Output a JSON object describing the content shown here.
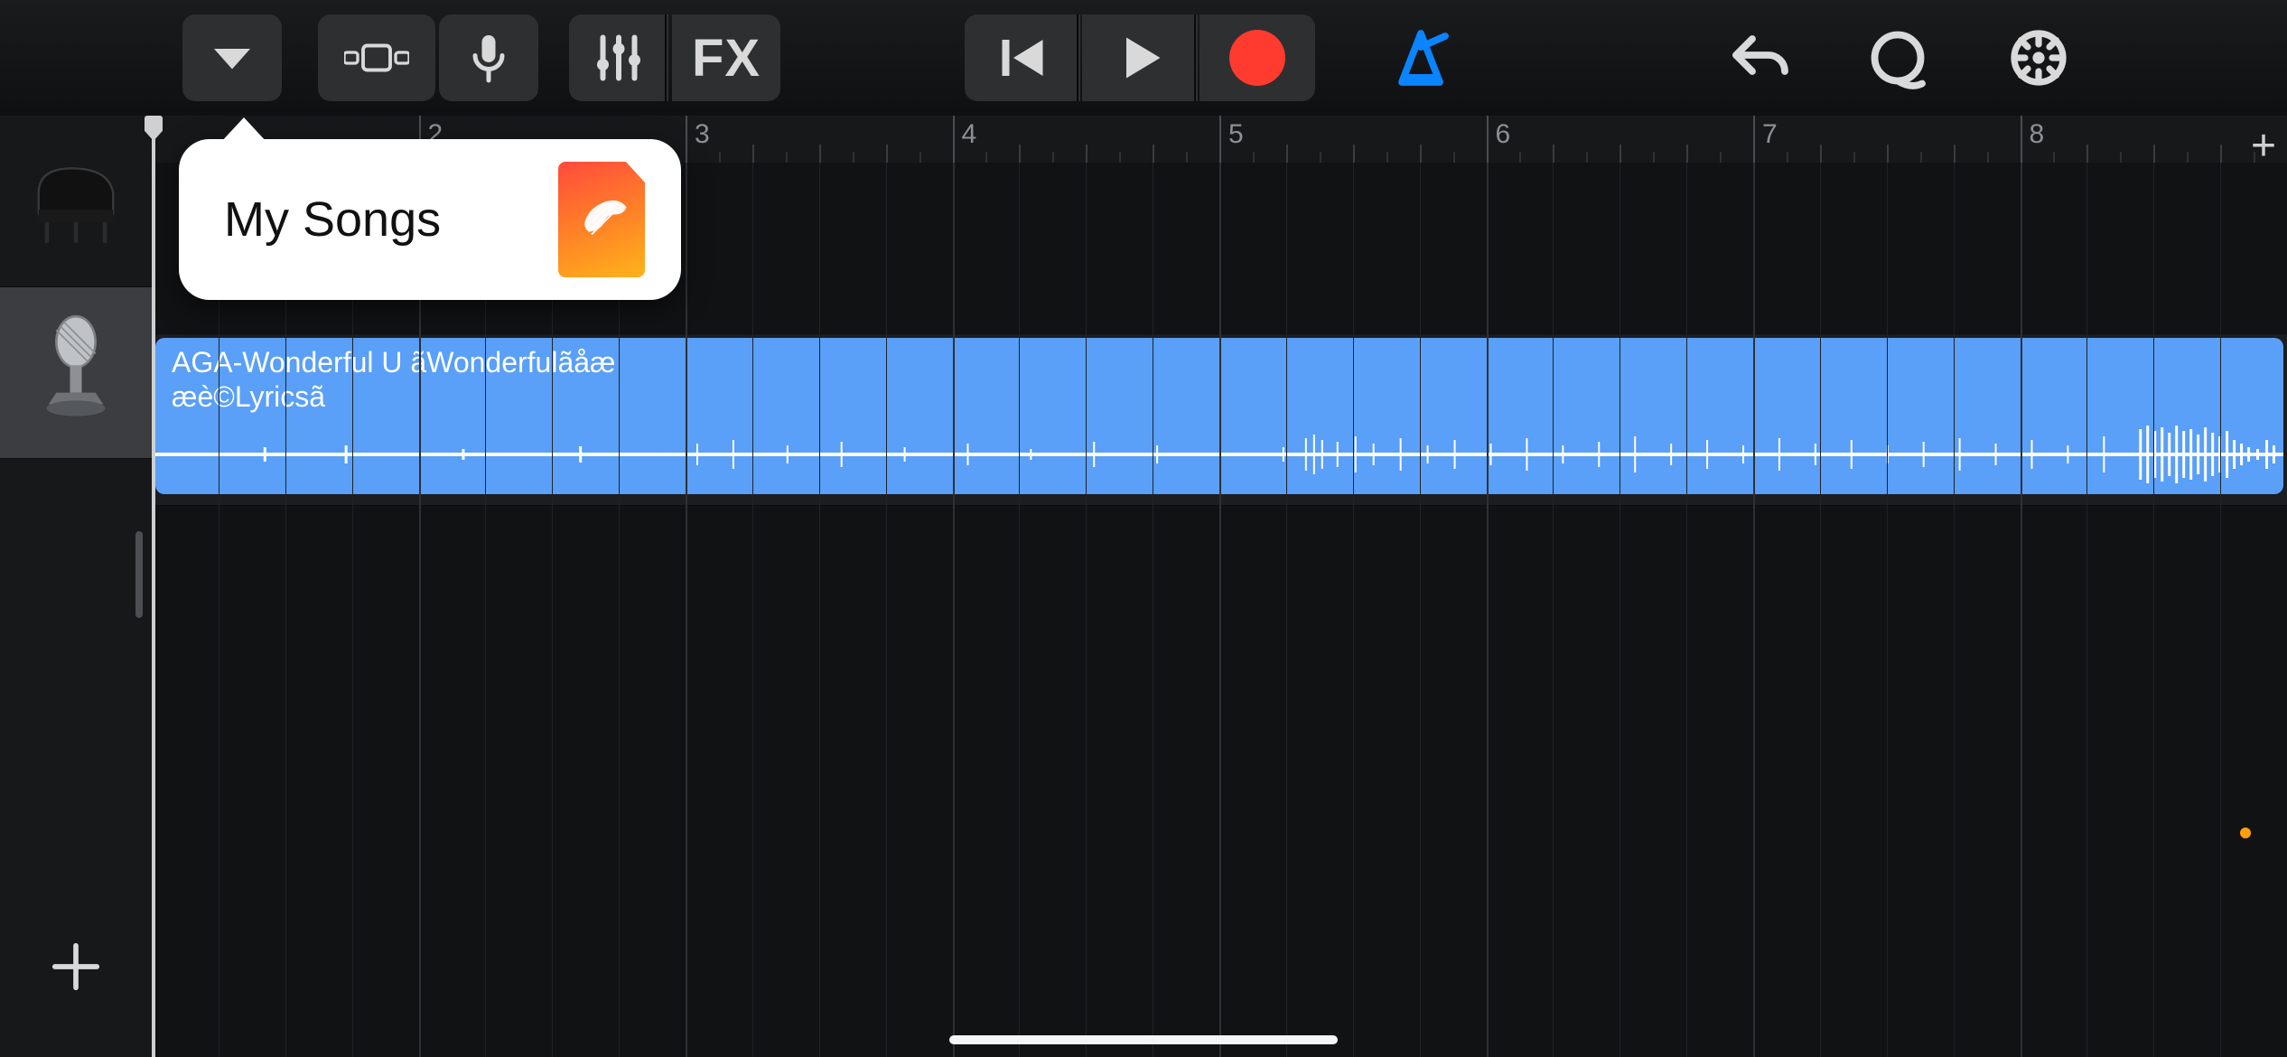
{
  "toolbar": {
    "menu_icon": "chevron-down",
    "view_icon": "track-view",
    "mic_icon": "microphone",
    "mixer_icon": "sliders",
    "fx_label": "FX",
    "rewind_icon": "skip-back",
    "play_icon": "play",
    "record_icon": "record",
    "metronome_icon": "metronome",
    "metronome_active_color": "#0a84ff",
    "undo_icon": "undo",
    "loop_browser_icon": "loop",
    "settings_icon": "gear"
  },
  "popover": {
    "label": "My Songs",
    "doc_icon": "garageband-guitar"
  },
  "ruler": {
    "bar_labels": [
      "2",
      "3",
      "4",
      "5",
      "6",
      "7",
      "8"
    ],
    "add_section_glyph": "+"
  },
  "tracks": [
    {
      "kind": "software-instrument",
      "icon": "grand-piano",
      "selected": false
    },
    {
      "kind": "audio",
      "icon": "studio-microphone",
      "selected": true
    }
  ],
  "regions": [
    {
      "track_index": 1,
      "title": "AGA-Wonderful U ãWonderfulãåæ\næè©Lyricsã",
      "color": "#5a9ff8"
    }
  ],
  "add_track_glyph": "+",
  "accent_orange": "#ff9f0a"
}
